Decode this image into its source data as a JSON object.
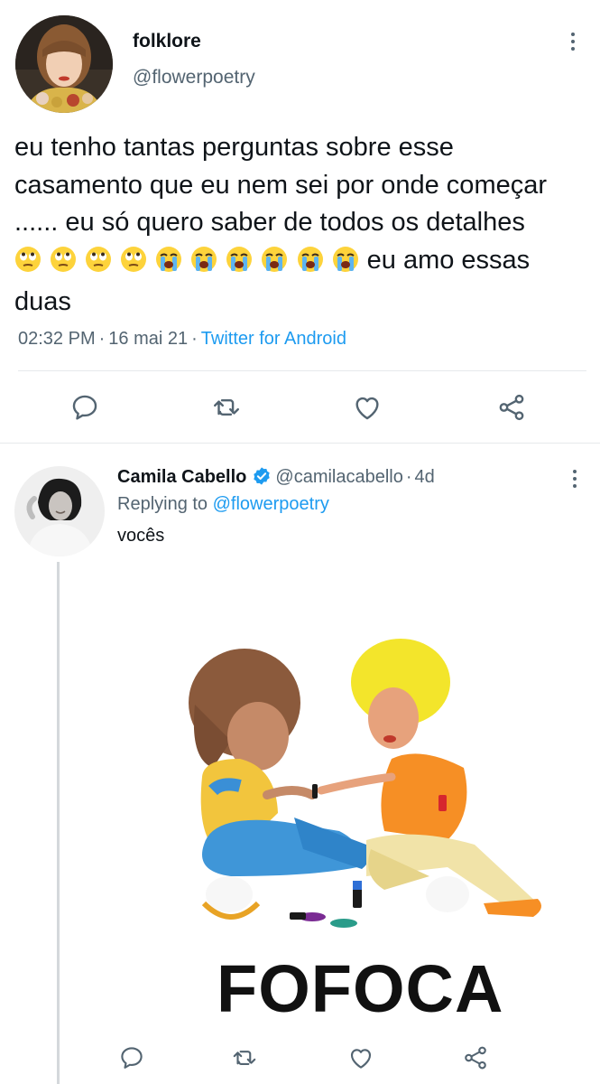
{
  "main_tweet": {
    "display_name": "folklore",
    "handle": "@flowerpoetry",
    "text_before_emoji": "eu tenho tantas perguntas sobre esse casamento que eu nem sei por onde começar ...... eu só quero saber de todos os detalhes",
    "emoji_icons": [
      "face-with-rolling-eyes-icon",
      "face-with-rolling-eyes-icon",
      "face-with-rolling-eyes-icon",
      "face-with-rolling-eyes-icon",
      "loudly-crying-face-icon",
      "loudly-crying-face-icon",
      "loudly-crying-face-icon",
      "loudly-crying-face-icon",
      "loudly-crying-face-icon",
      "loudly-crying-face-icon"
    ],
    "text_after_emoji": "eu amo essas duas",
    "time": "02:32 PM",
    "date": "16 mai 21",
    "source": "Twitter for Android"
  },
  "reply_tweet": {
    "display_name": "Camila Cabello",
    "handle": "@camilacabello",
    "age": "4d",
    "separator": "·",
    "replying_to_label": "Replying to",
    "replying_to_handle": "@flowerpoetry",
    "text": "vocês",
    "gif_caption": "FOFOCA"
  },
  "meta_separator": "·",
  "colors": {
    "link": "#1d9bf0",
    "secondary_text": "#536471",
    "primary_text": "#0f1419",
    "divider": "#e6e9ec"
  }
}
